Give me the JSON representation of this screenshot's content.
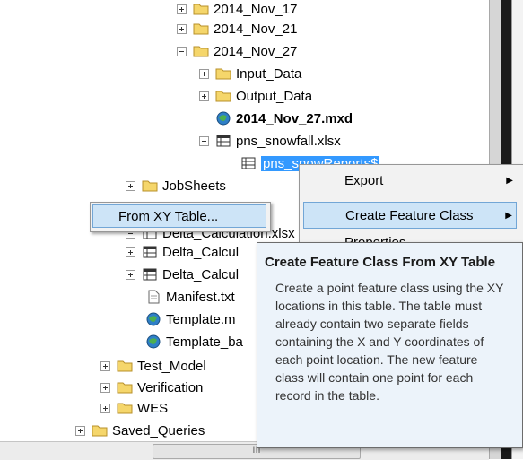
{
  "tree": [
    {
      "label": "2014_Nov_17",
      "expander": "plus",
      "icon": "folder-icon"
    },
    {
      "label": "2014_Nov_21",
      "expander": "plus",
      "icon": "folder-icon"
    },
    {
      "label": "2014_Nov_27",
      "expander": "minus",
      "icon": "folder-icon"
    },
    {
      "label": "Input_Data",
      "expander": "plus",
      "icon": "folder-icon"
    },
    {
      "label": "Output_Data",
      "expander": "plus",
      "icon": "folder-icon"
    },
    {
      "label": "2014_Nov_27.mxd",
      "expander": "none",
      "icon": "map-document-icon"
    },
    {
      "label": "pns_snowfall.xlsx",
      "expander": "minus",
      "icon": "workbook-icon"
    },
    {
      "label": "pns_snowReports$",
      "expander": "none",
      "icon": "table-icon"
    },
    {
      "label": "JobSheets",
      "expander": "plus",
      "icon": "folder-icon"
    },
    {
      "label": "Delta_Calculation.xlsx",
      "expander": "minus",
      "icon": "workbook-icon"
    },
    {
      "label": "Delta_Calcul",
      "expander": "plus",
      "icon": "workbook-icon"
    },
    {
      "label": "Delta_Calcul",
      "expander": "plus",
      "icon": "workbook-icon"
    },
    {
      "label": "Manifest.txt",
      "expander": "none",
      "icon": "text-file-icon"
    },
    {
      "label": "Template.m",
      "expander": "none",
      "icon": "map-document-icon"
    },
    {
      "label": "Template_ba",
      "expander": "none",
      "icon": "map-document-icon"
    },
    {
      "label": "Test_Model",
      "expander": "plus",
      "icon": "folder-icon"
    },
    {
      "label": "Verification",
      "expander": "plus",
      "icon": "folder-icon"
    },
    {
      "label": "WES",
      "expander": "plus",
      "icon": "folder-icon"
    },
    {
      "label": "Saved_Queries",
      "expander": "plus",
      "icon": "folder-icon"
    }
  ],
  "scrollbar": {
    "thumb_grip": "III"
  },
  "context_menu": {
    "items": [
      {
        "label": "Export",
        "arrow": "▶"
      },
      {
        "label": "Create Feature Class",
        "arrow": "▶"
      },
      {
        "label": "Properties...",
        "arrow": ""
      }
    ]
  },
  "submenu": {
    "item": "From XY Table..."
  },
  "tooltip": {
    "title": "Create Feature Class From XY Table",
    "body": "Create a point feature class using the XY locations in this table. The table must already contain two separate fields containing the X and Y coordinates of each point location. The new feature class will contain one point for each record in the table."
  },
  "colors": {
    "selection": "#3399ff",
    "menu_highlight": "#cde4f7",
    "tooltip_bg": "#ecf3fa",
    "folder": "#f0c84a"
  }
}
